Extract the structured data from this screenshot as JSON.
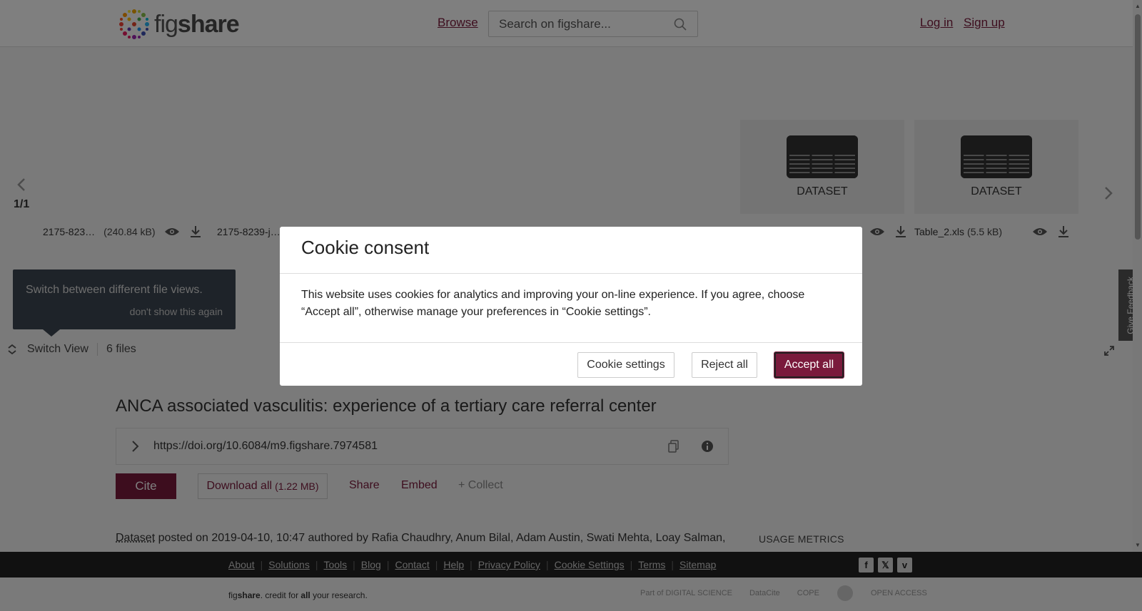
{
  "header": {
    "logo_text_light": "fig",
    "logo_text_bold": "share",
    "browse": "Browse",
    "search_placeholder": "Search on figshare...",
    "login": "Log in",
    "signup": "Sign up"
  },
  "viewer": {
    "counter": "1/1",
    "files": [
      {
        "name": "2175-823…",
        "size": "(240.84 kB)"
      },
      {
        "name": "2175-8239-j…",
        "size": ""
      },
      {
        "name": "Table_2.xls",
        "size": "(5.5 kB)"
      }
    ],
    "thumb_label": "DATASET",
    "tooltip_message": "Switch between different file views.",
    "tooltip_dismiss": "don't show this again",
    "switch_view": "Switch View",
    "file_count": "6 files"
  },
  "feedback": "Give Feedback",
  "item": {
    "title": "ANCA associated vasculitis: experience of a tertiary care referral center",
    "doi": "https://doi.org/10.6084/m9.figshare.7974581",
    "cite": "Cite",
    "download_all": "Download all",
    "download_size": "(1.22 MB)",
    "share": "Share",
    "embed": "Embed",
    "collect": "+ Collect",
    "type": "Dataset",
    "posted_text": " posted on 2019-04-10, 10:47 authored by Rafia Chaudhry, Anum Bilal, Adam Austin, Swati Mehta, Loay Salman,",
    "usage_metrics": "USAGE METRICS"
  },
  "footer": {
    "links": [
      "About",
      "Solutions",
      "Tools",
      "Blog",
      "Contact",
      "Help",
      "Privacy Policy",
      "Cookie Settings",
      "Terms",
      "Sitemap"
    ],
    "tagline_pre": "fig",
    "tagline_bold": "share",
    "tagline_mid": ". credit for ",
    "tagline_all": "all",
    "tagline_post": " your research.",
    "partners": [
      "Part of DIGITAL SCIENCE",
      "DataCite",
      "COPE",
      "",
      "OPEN ACCESS"
    ]
  },
  "cookie": {
    "title": "Cookie consent",
    "body": "This website uses cookies for analytics and improving your on-line experience. If you agree, choose “Accept all”, otherwise manage your preferences in “Cookie settings”.",
    "settings": "Cookie settings",
    "reject": "Reject all",
    "accept": "Accept all"
  },
  "colors": {
    "brand": "#7a1a3c",
    "overlay": "rgba(0,0,0,0.5)",
    "tooltip_bg": "#3d4752",
    "footer_bg": "#222222"
  }
}
